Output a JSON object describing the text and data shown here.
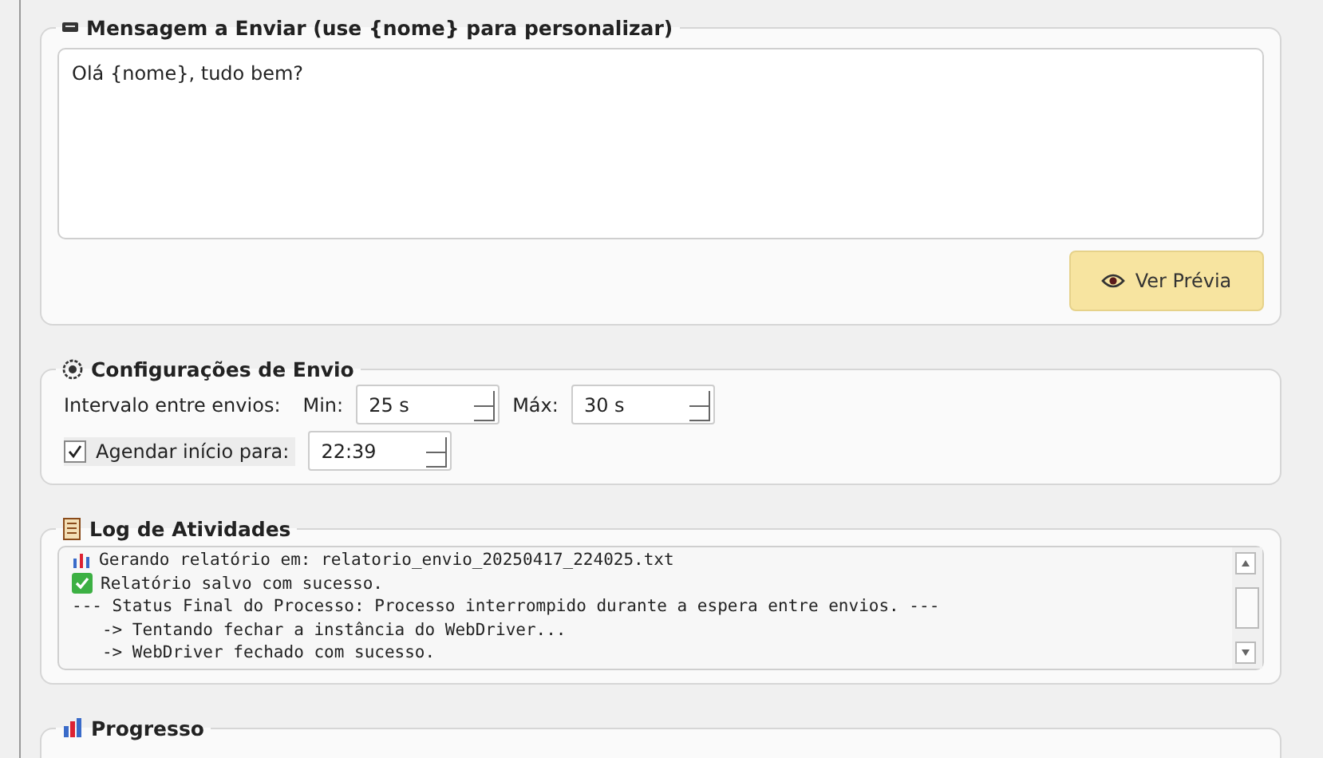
{
  "message_panel": {
    "title": "Mensagem a Enviar (use {nome} para personalizar)",
    "message": "Olá {nome}, tudo bem?",
    "preview_button": "Ver Prévia"
  },
  "settings_panel": {
    "title": "Configurações de Envio",
    "interval_label": "Intervalo entre envios:",
    "min_label": "Min:",
    "min_value": "25 s",
    "max_label": "Máx:",
    "max_value": "30 s",
    "schedule": {
      "label": "Agendar início para:",
      "checked": true,
      "value": "22:39"
    }
  },
  "log_panel": {
    "title": "Log de Atividades",
    "lines": [
      {
        "kind": "chart",
        "text": "Gerando relatório em: relatorio_envio_20250417_224025.txt"
      },
      {
        "kind": "success",
        "text": "Relatório salvo com sucesso."
      },
      {
        "kind": "plain",
        "text": "--- Status Final do Processo: Processo interrompido durante a espera entre envios. ---"
      },
      {
        "kind": "plain",
        "text": "   -> Tentando fechar a instância do WebDriver..."
      },
      {
        "kind": "plain",
        "text": "   -> WebDriver fechado com sucesso."
      }
    ]
  },
  "progress_panel": {
    "title": "Progresso"
  }
}
